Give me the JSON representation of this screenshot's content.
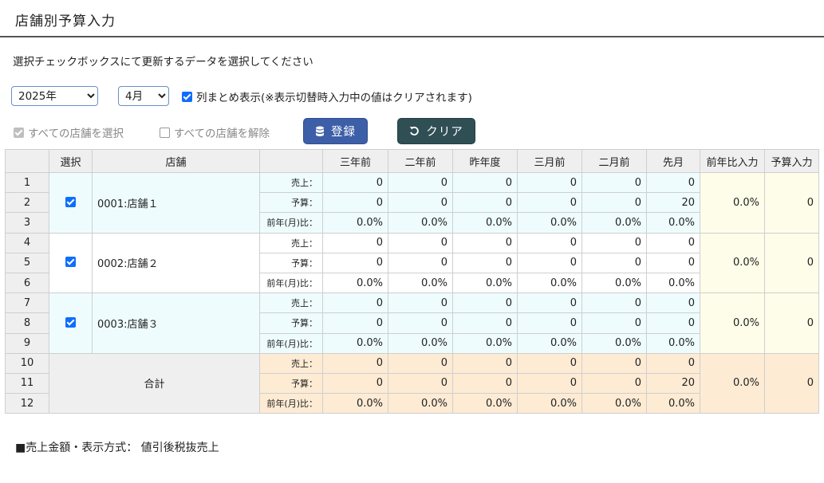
{
  "page_title": "店舗別予算入力",
  "instruction": "選択チェックボックスにて更新するデータを選択してください",
  "year_select": {
    "value": "2025年",
    "options": [
      "2025年"
    ]
  },
  "month_select": {
    "value": "4月",
    "options": [
      "4月"
    ]
  },
  "column_merge": {
    "checked": true,
    "label": "列まとめ表示(※表示切替時入力中の値はクリアされます)"
  },
  "select_all": {
    "checked": true,
    "label": "すべての店舗を選択"
  },
  "deselect_all": {
    "checked": false,
    "label": "すべての店舗を解除"
  },
  "buttons": {
    "register": "登録",
    "clear": "クリア"
  },
  "icons": {
    "register": "database-icon",
    "clear": "undo-icon"
  },
  "table": {
    "headers": [
      "選択",
      "店舗",
      "",
      "三年前",
      "二年前",
      "昨年度",
      "三月前",
      "二月前",
      "先月",
      "前年比入力",
      "予算入力"
    ],
    "row_labels": [
      "売上：",
      "予算：",
      "前年(月)比："
    ],
    "stores": [
      {
        "nums": [
          "1",
          "2",
          "3"
        ],
        "checked": true,
        "name": "0001:店舗１",
        "rows": [
          [
            "0",
            "0",
            "0",
            "0",
            "0",
            "0"
          ],
          [
            "0",
            "0",
            "0",
            "0",
            "0",
            "20"
          ],
          [
            "0.0%",
            "0.0%",
            "0.0%",
            "0.0%",
            "0.0%",
            "0.0%"
          ]
        ],
        "yoy_input": "0.0%",
        "budget_input": "0"
      },
      {
        "nums": [
          "4",
          "5",
          "6"
        ],
        "checked": true,
        "name": "0002:店舗２",
        "rows": [
          [
            "0",
            "0",
            "0",
            "0",
            "0",
            "0"
          ],
          [
            "0",
            "0",
            "0",
            "0",
            "0",
            "0"
          ],
          [
            "0.0%",
            "0.0%",
            "0.0%",
            "0.0%",
            "0.0%",
            "0.0%"
          ]
        ],
        "yoy_input": "0.0%",
        "budget_input": "0"
      },
      {
        "nums": [
          "7",
          "8",
          "9"
        ],
        "checked": true,
        "name": "0003:店舗３",
        "rows": [
          [
            "0",
            "0",
            "0",
            "0",
            "0",
            "0"
          ],
          [
            "0",
            "0",
            "0",
            "0",
            "0",
            "0"
          ],
          [
            "0.0%",
            "0.0%",
            "0.0%",
            "0.0%",
            "0.0%",
            "0.0%"
          ]
        ],
        "yoy_input": "0.0%",
        "budget_input": "0"
      }
    ],
    "total": {
      "nums": [
        "10",
        "11",
        "12"
      ],
      "label": "合計",
      "rows": [
        [
          "0",
          "0",
          "0",
          "0",
          "0",
          "0"
        ],
        [
          "0",
          "0",
          "0",
          "0",
          "0",
          "20"
        ],
        [
          "0.0%",
          "0.0%",
          "0.0%",
          "0.0%",
          "0.0%",
          "0.0%"
        ]
      ],
      "yoy_input": "0.0%",
      "budget_input": "0"
    }
  },
  "footnote": "■売上金額・表示方式： 値引後税抜売上",
  "colors": {
    "store_band": "#eefcfd",
    "input_col": "#fdfde9",
    "total": "#fdebd4",
    "register_btn": "#3d5fa8",
    "clear_btn": "#2f4f55"
  }
}
